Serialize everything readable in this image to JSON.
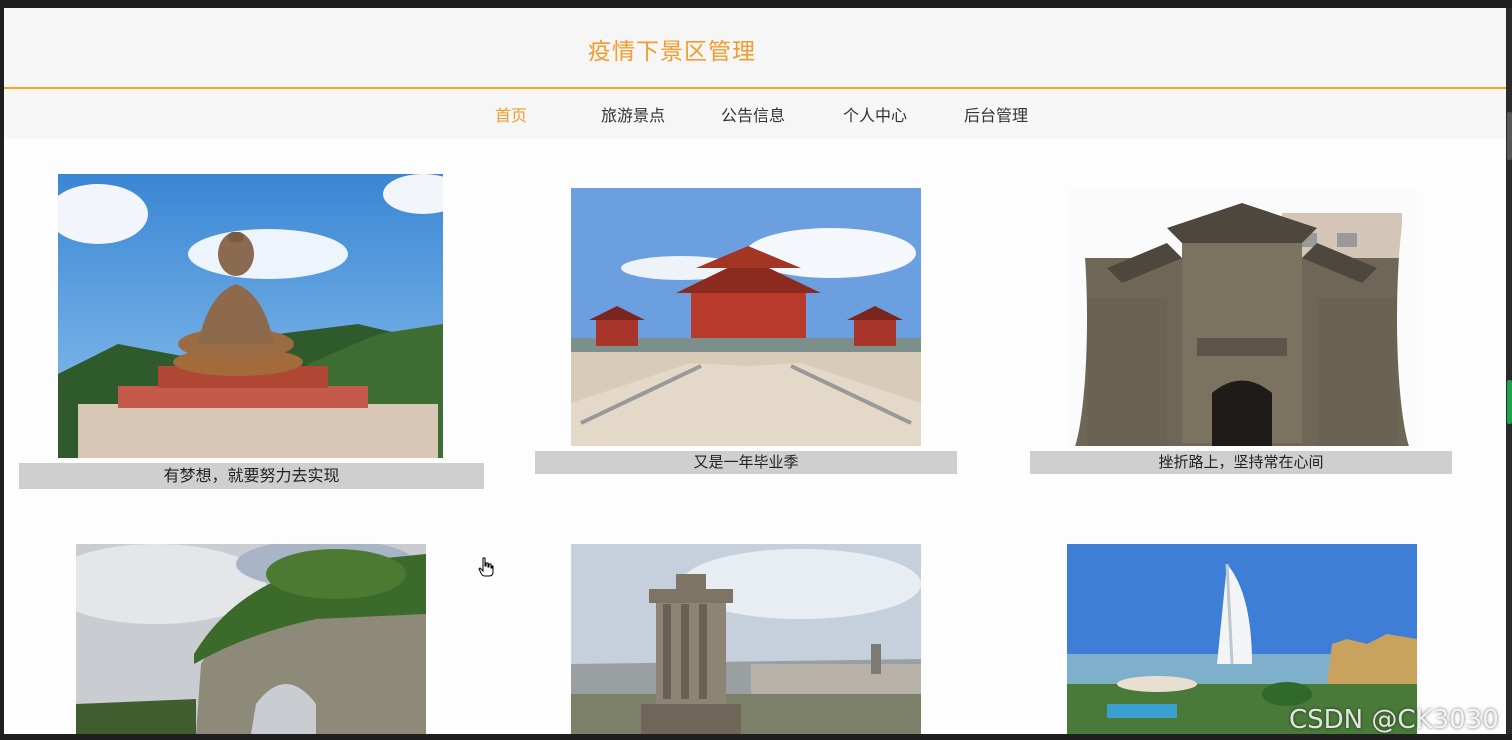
{
  "header": {
    "title": "疫情下景区管理"
  },
  "nav": {
    "items": [
      {
        "label": "首页",
        "active": true
      },
      {
        "label": "旅游景点",
        "active": false
      },
      {
        "label": "公告信息",
        "active": false
      },
      {
        "label": "个人中心",
        "active": false
      },
      {
        "label": "后台管理",
        "active": false
      }
    ]
  },
  "cards": [
    {
      "caption": "有梦想，就要努力去实现",
      "image": "giant-buddha-statue"
    },
    {
      "caption": "又是一年毕业季",
      "image": "chinese-temple-pagoda"
    },
    {
      "caption": "挫折路上，坚持常在心间",
      "image": "ancient-stone-gate"
    },
    {
      "caption": "",
      "image": "elephant-trunk-hill"
    },
    {
      "caption": "",
      "image": "edinburgh-monument"
    },
    {
      "caption": "",
      "image": "burj-al-arab-resort"
    }
  ],
  "watermark": "CSDN @CK3030"
}
